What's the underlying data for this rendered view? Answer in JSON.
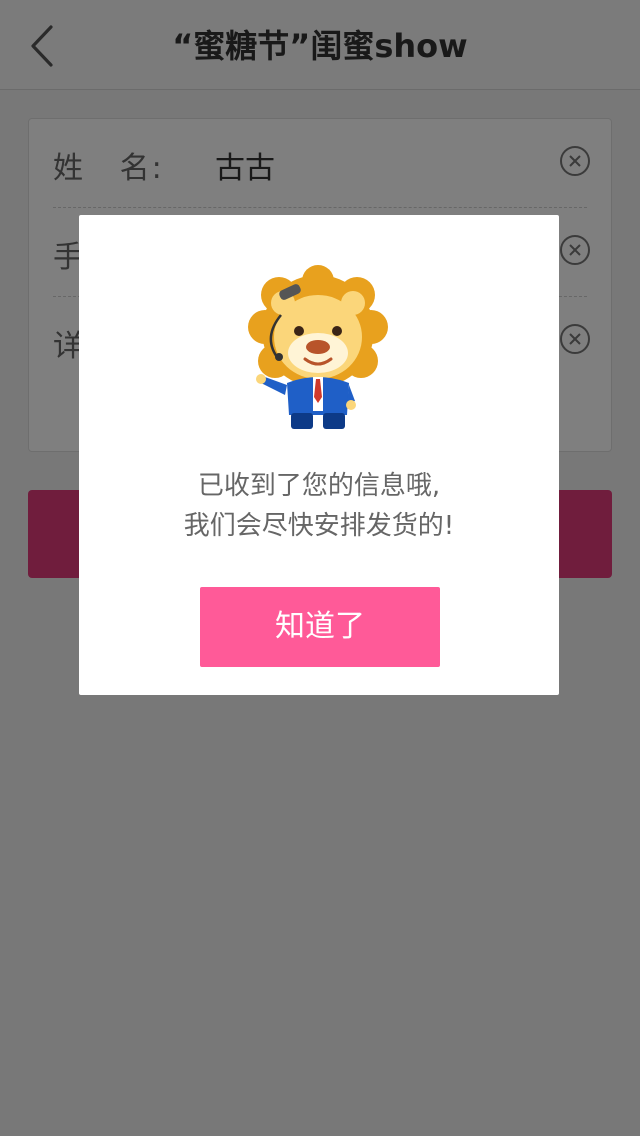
{
  "header": {
    "title": "“蜜糖节”闺蜜show"
  },
  "form": {
    "rows": [
      {
        "label": "姓   名:",
        "value": "古古"
      },
      {
        "label": "手",
        "value": ""
      },
      {
        "label": "详",
        "value": ""
      }
    ]
  },
  "dialog": {
    "message_line1": "已收到了您的信息哦,",
    "message_line2": "我们会尽快安排发货的!",
    "ok_label": "知道了"
  },
  "colors": {
    "accent": "#ff5a98",
    "submit": "#e03a7a",
    "overlay": "rgba(0,0,0,0.5)"
  }
}
